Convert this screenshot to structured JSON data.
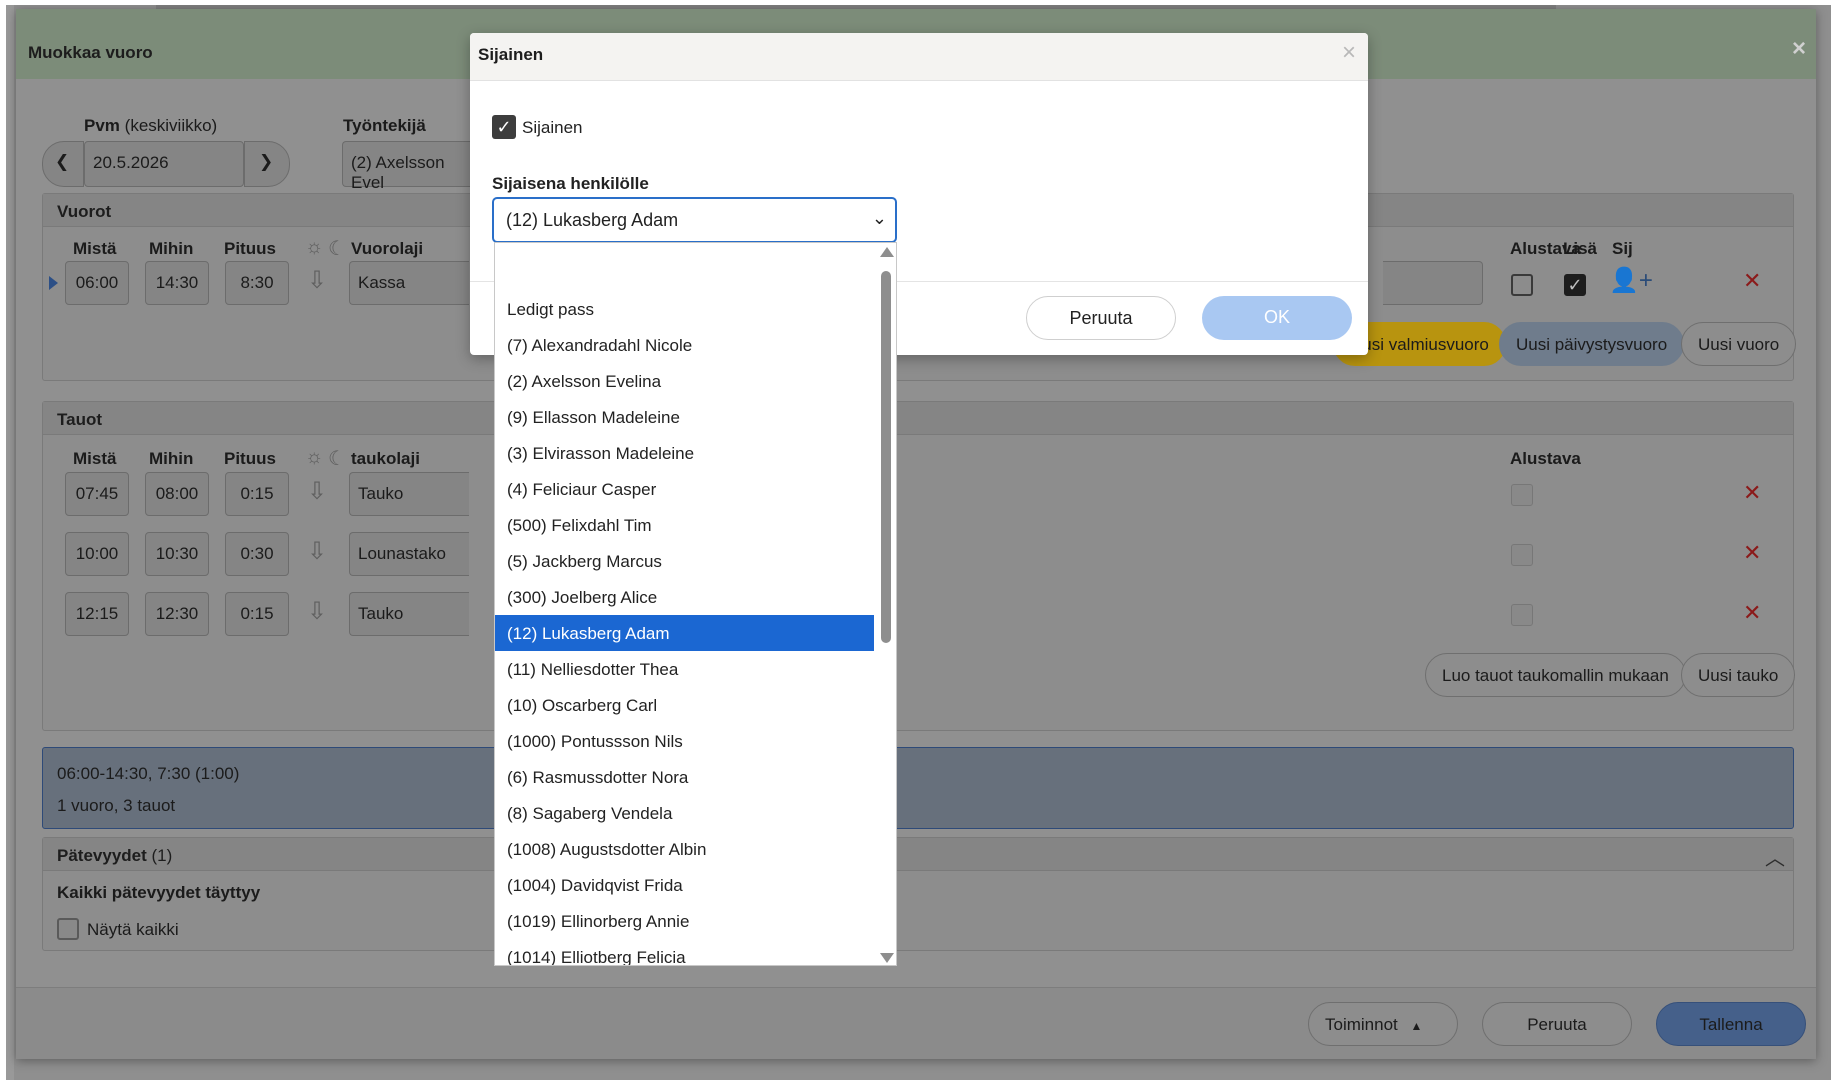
{
  "edit_dialog": {
    "title": "Muokkaa vuoro",
    "date_label": "Pvm",
    "date_weekday": "(keskiviikko)",
    "date_value": "20.5.2026",
    "employee_label": "Työntekijä",
    "employee_value": "(2) Axelsson Evel",
    "shifts": {
      "title": "Vuorot",
      "col_from": "Mistä",
      "col_to": "Mihin",
      "col_length": "Pituus",
      "col_type": "Vuorolaji",
      "col_preliminary": "Alustava",
      "col_extra": "Lisä",
      "col_sub": "Sij",
      "row": {
        "from": "06:00",
        "to": "14:30",
        "length": "8:30",
        "type": "Kassa"
      }
    },
    "shift_buttons": {
      "standby": "Uusi valmiusvuoro",
      "update": "Uusi päivystysvuoro",
      "new": "Uusi vuoro"
    },
    "breaks": {
      "title": "Tauot",
      "col_from": "Mistä",
      "col_to": "Mihin",
      "col_length": "Pituus",
      "col_type": "taukolaji",
      "col_preliminary": "Alustava",
      "rows": [
        {
          "from": "07:45",
          "to": "08:00",
          "length": "0:15",
          "type": "Tauko"
        },
        {
          "from": "10:00",
          "to": "10:30",
          "length": "0:30",
          "type": "Lounastako"
        },
        {
          "from": "12:15",
          "to": "12:30",
          "length": "0:15",
          "type": "Tauko"
        }
      ],
      "btn_template": "Luo tauot taukomallin mukaan",
      "btn_new": "Uusi tauko"
    },
    "summary": {
      "line1": "06:00-14:30, 7:30 (1:00)",
      "line2": "1 vuoro, 3 tauot"
    },
    "qualifications": {
      "title": "Pätevyydet",
      "count": "(1)",
      "status": "Kaikki pätevyydet täyttyy",
      "show_all": "Näytä kaikki"
    },
    "footer": {
      "actions": "Toiminnot",
      "cancel": "Peruuta",
      "save": "Tallenna"
    }
  },
  "substitute_modal": {
    "title": "Sijainen",
    "checkbox_label": "Sijainen",
    "field_label": "Sijaisena henkilölle",
    "selected": "(12) Lukasberg Adam",
    "cancel": "Peruuta",
    "ok": "OK"
  },
  "dropdown": {
    "options": [
      "",
      "Ledigt pass",
      "(7) Alexandradahl Nicole",
      "(2) Axelsson Evelina",
      "(9) Ellasson Madeleine",
      "(3) Elvirasson Madeleine",
      "(4) Feliciaur Casper",
      "(500) Felixdahl Tim",
      "(5) Jackberg Marcus",
      "(300) Joelberg Alice",
      "(12) Lukasberg Adam",
      "(11) Nelliesdotter Thea",
      "(10) Oscarberg Carl",
      "(1000) Pontussson Nils",
      "(6) Rasmussdotter Nora",
      "(8) Sagaberg Vendela",
      "(1008) Augustsdotter Albin",
      "(1004) Davidqvist Frida",
      "(1019) Ellinorberg Annie",
      "(1014) Elliotberg Felicia"
    ],
    "selected_index": 10
  },
  "icons": {
    "prev": "chevron-left-icon",
    "next": "chevron-right-icon",
    "sun": "sun-icon",
    "moon": "moon-icon",
    "download": "download-icon",
    "remove": "close-icon",
    "add_person": "add-person-icon",
    "collapse": "chevron-up-icon",
    "dropdown_arrow": "chevron-down-icon"
  },
  "colors": {
    "accent": "#1b67d2",
    "ok_button": "#a9c8f2",
    "standby_button": "#b8940f",
    "remove_x": "#d42a2a"
  }
}
